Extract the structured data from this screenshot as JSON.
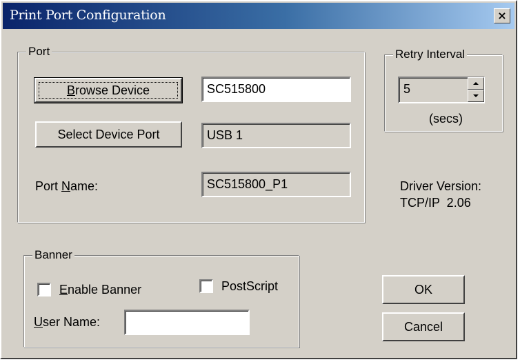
{
  "window": {
    "title": "Print Port Configuration",
    "close_glyph": "×"
  },
  "port_group": {
    "label": "Port",
    "browse_button": {
      "pre": "",
      "accel": "B",
      "post": "rowse Device"
    },
    "device_field_value": "SC515800",
    "select_port_button": "Select Device Port",
    "port_field_value": "USB 1",
    "port_name_label": {
      "pre": "Port ",
      "accel": "N",
      "post": "ame:"
    },
    "port_name_value": "SC515800_P1"
  },
  "retry_group": {
    "label": "Retry Interval",
    "value": "5",
    "units": "(secs)"
  },
  "driver_version": {
    "label": "Driver Version:",
    "value": "TCP/IP  2.06"
  },
  "banner_group": {
    "label": "Banner",
    "enable_banner": {
      "pre": "",
      "accel": "E",
      "post": "nable Banner",
      "checked": false
    },
    "postscript": {
      "label": "PostScript",
      "checked": false
    },
    "user_name_label": {
      "pre": "",
      "accel": "U",
      "post": "ser Name:"
    },
    "user_name_value": ""
  },
  "buttons": {
    "ok": "OK",
    "cancel": "Cancel"
  },
  "colors": {
    "face": "#d4d0c8",
    "title_start": "#0a246a",
    "title_end": "#a6caf0"
  }
}
